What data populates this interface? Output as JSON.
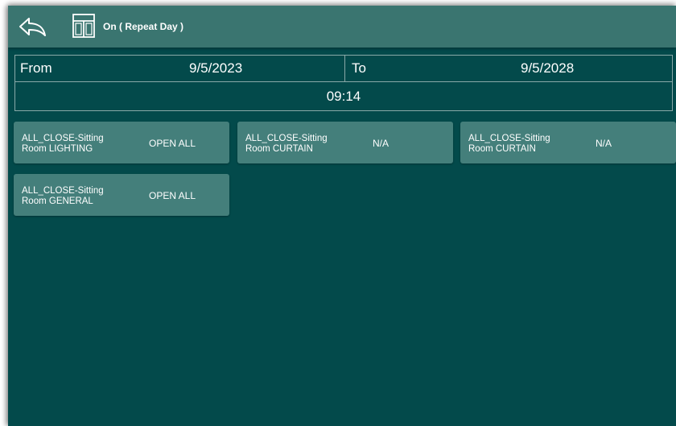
{
  "header": {
    "title": "On ( Repeat Day )",
    "back_icon": "back-arrow-icon",
    "layout_icon": "layout-panel-icon"
  },
  "date_range": {
    "from_label": "From",
    "from_value": "9/5/2023",
    "to_label": "To",
    "to_value": "9/5/2028"
  },
  "time": "09:14",
  "scenes": [
    {
      "name_line1": "ALL_CLOSE-Sitting",
      "name_line2": "Room LIGHTING",
      "state": "OPEN ALL"
    },
    {
      "name_line1": "ALL_CLOSE-Sitting",
      "name_line2": "Room CURTAIN",
      "state": "N/A"
    },
    {
      "name_line1": "ALL_CLOSE-Sitting",
      "name_line2": "Room CURTAIN",
      "state": "N/A"
    },
    {
      "name_line1": "ALL_CLOSE-Sitting",
      "name_line2": "Room GENERAL",
      "state": "OPEN ALL"
    }
  ],
  "colors": {
    "background": "#034a4b",
    "header": "#3a7570",
    "card": "#447f7b",
    "border": "#8aa9a8"
  }
}
